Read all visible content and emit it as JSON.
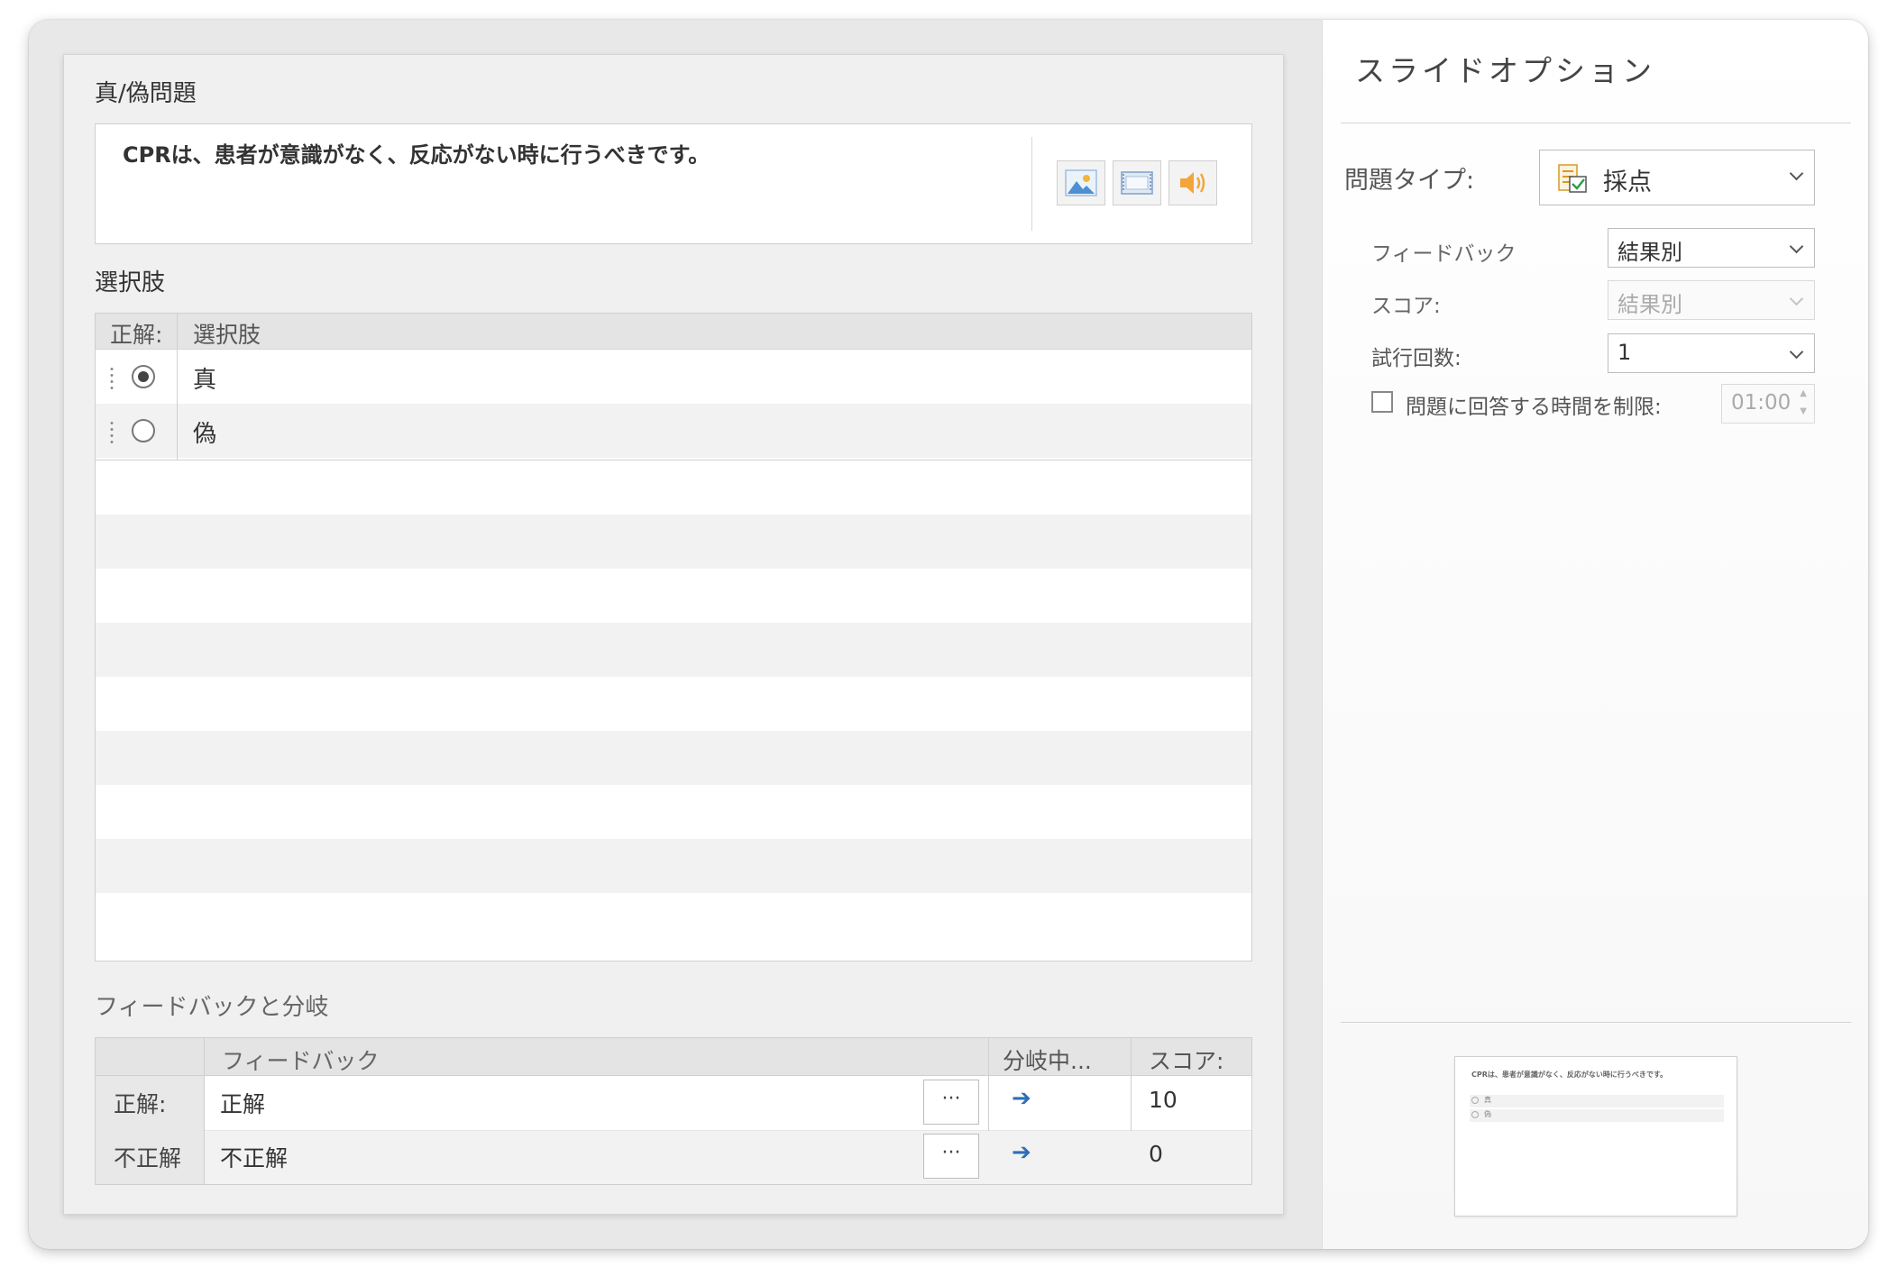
{
  "editor": {
    "question_section_label": "真/偽問題",
    "question_text": "CPRは、患者が意識がなく、反応がない時に行うべきです。",
    "media_buttons": [
      {
        "icon": "image-icon"
      },
      {
        "icon": "video-icon"
      },
      {
        "icon": "audio-icon"
      }
    ],
    "choices_section_label": "選択肢",
    "choices_table": {
      "col_correct": "正解:",
      "col_choice": "選択肢",
      "rows": [
        {
          "label": "真",
          "selected": true
        },
        {
          "label": "偽",
          "selected": false
        }
      ]
    },
    "feedback_section_label": "フィードバックと分岐",
    "feedback_table": {
      "col_feedback": "フィードバック",
      "col_branch": "分岐中...",
      "col_score": "スコア:",
      "rows": [
        {
          "header": "正解:",
          "feedback": "正解",
          "more": "···",
          "score": "10"
        },
        {
          "header": "不正解",
          "feedback": "不正解",
          "more": "···",
          "score": "0"
        }
      ]
    }
  },
  "options": {
    "title": "スライドオプション",
    "question_type_label": "問題タイプ:",
    "question_type_value": "採点",
    "feedback_label": "フィードバック",
    "feedback_value": "結果別",
    "score_label": "スコア:",
    "score_value": "結果別",
    "attempts_label": "試行回数:",
    "attempts_value": "1",
    "time_limit_label": "問題に回答する時間を制限:",
    "time_limit_value": "01:00",
    "time_limit_checked": false
  },
  "preview": {
    "text": "CPRは、患者が意識がなく、反応がない時に行うべきです。",
    "choices": [
      "真",
      "偽"
    ]
  },
  "colors": {
    "arrow": "#2f6fb5",
    "stripe": "#f2f2f2",
    "panel_bg": "#e8e8e8"
  }
}
